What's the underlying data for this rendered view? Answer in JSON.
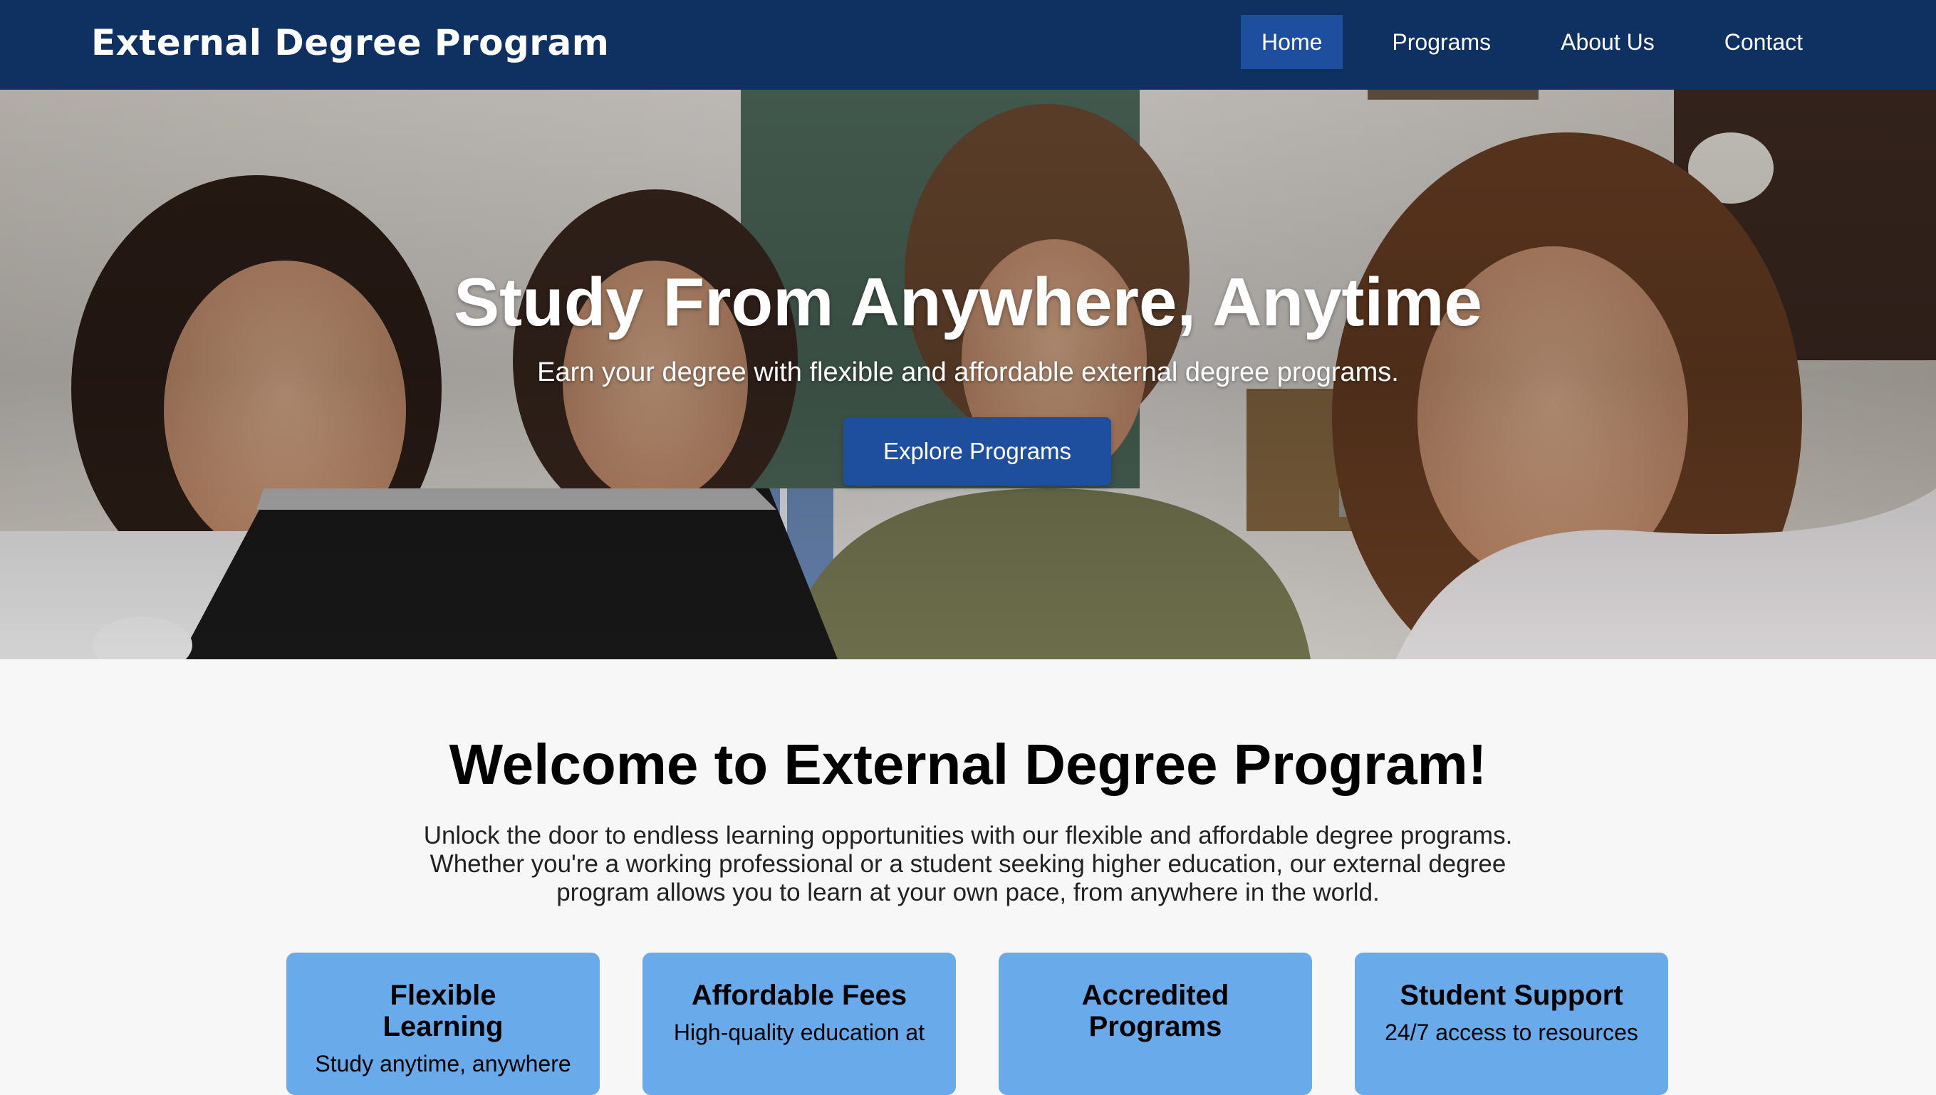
{
  "navbar": {
    "brand": "External Degree Program",
    "links": [
      {
        "label": "Home",
        "active": true
      },
      {
        "label": "Programs",
        "active": false
      },
      {
        "label": "About Us",
        "active": false
      },
      {
        "label": "Contact",
        "active": false
      }
    ],
    "background_color": "#0f3162",
    "active_color": "#1d4f9e"
  },
  "hero": {
    "title": "Study From Anywhere, Anytime",
    "subtitle": "Earn your degree with flexible and affordable external degree programs.",
    "cta_label": "Explore Programs",
    "image_description_icon": "group-of-students-photo"
  },
  "welcome": {
    "title": "Welcome to External Degree Program!",
    "text": "Unlock the door to endless learning opportunities with our flexible and affordable degree programs. Whether you're a working professional or a student seeking higher education, our external degree program allows you to learn at your own pace, from anywhere in the world."
  },
  "features": [
    {
      "title": "Flexible Learning",
      "description": "Study anytime, anywhere"
    },
    {
      "title": "Affordable Fees",
      "description": "High-quality education at"
    },
    {
      "title": "Accredited Programs",
      "description": ""
    },
    {
      "title": "Student Support",
      "description": "24/7 access to resources"
    }
  ],
  "colors": {
    "card_background": "#68aaea",
    "button": "#1d4f9e"
  }
}
